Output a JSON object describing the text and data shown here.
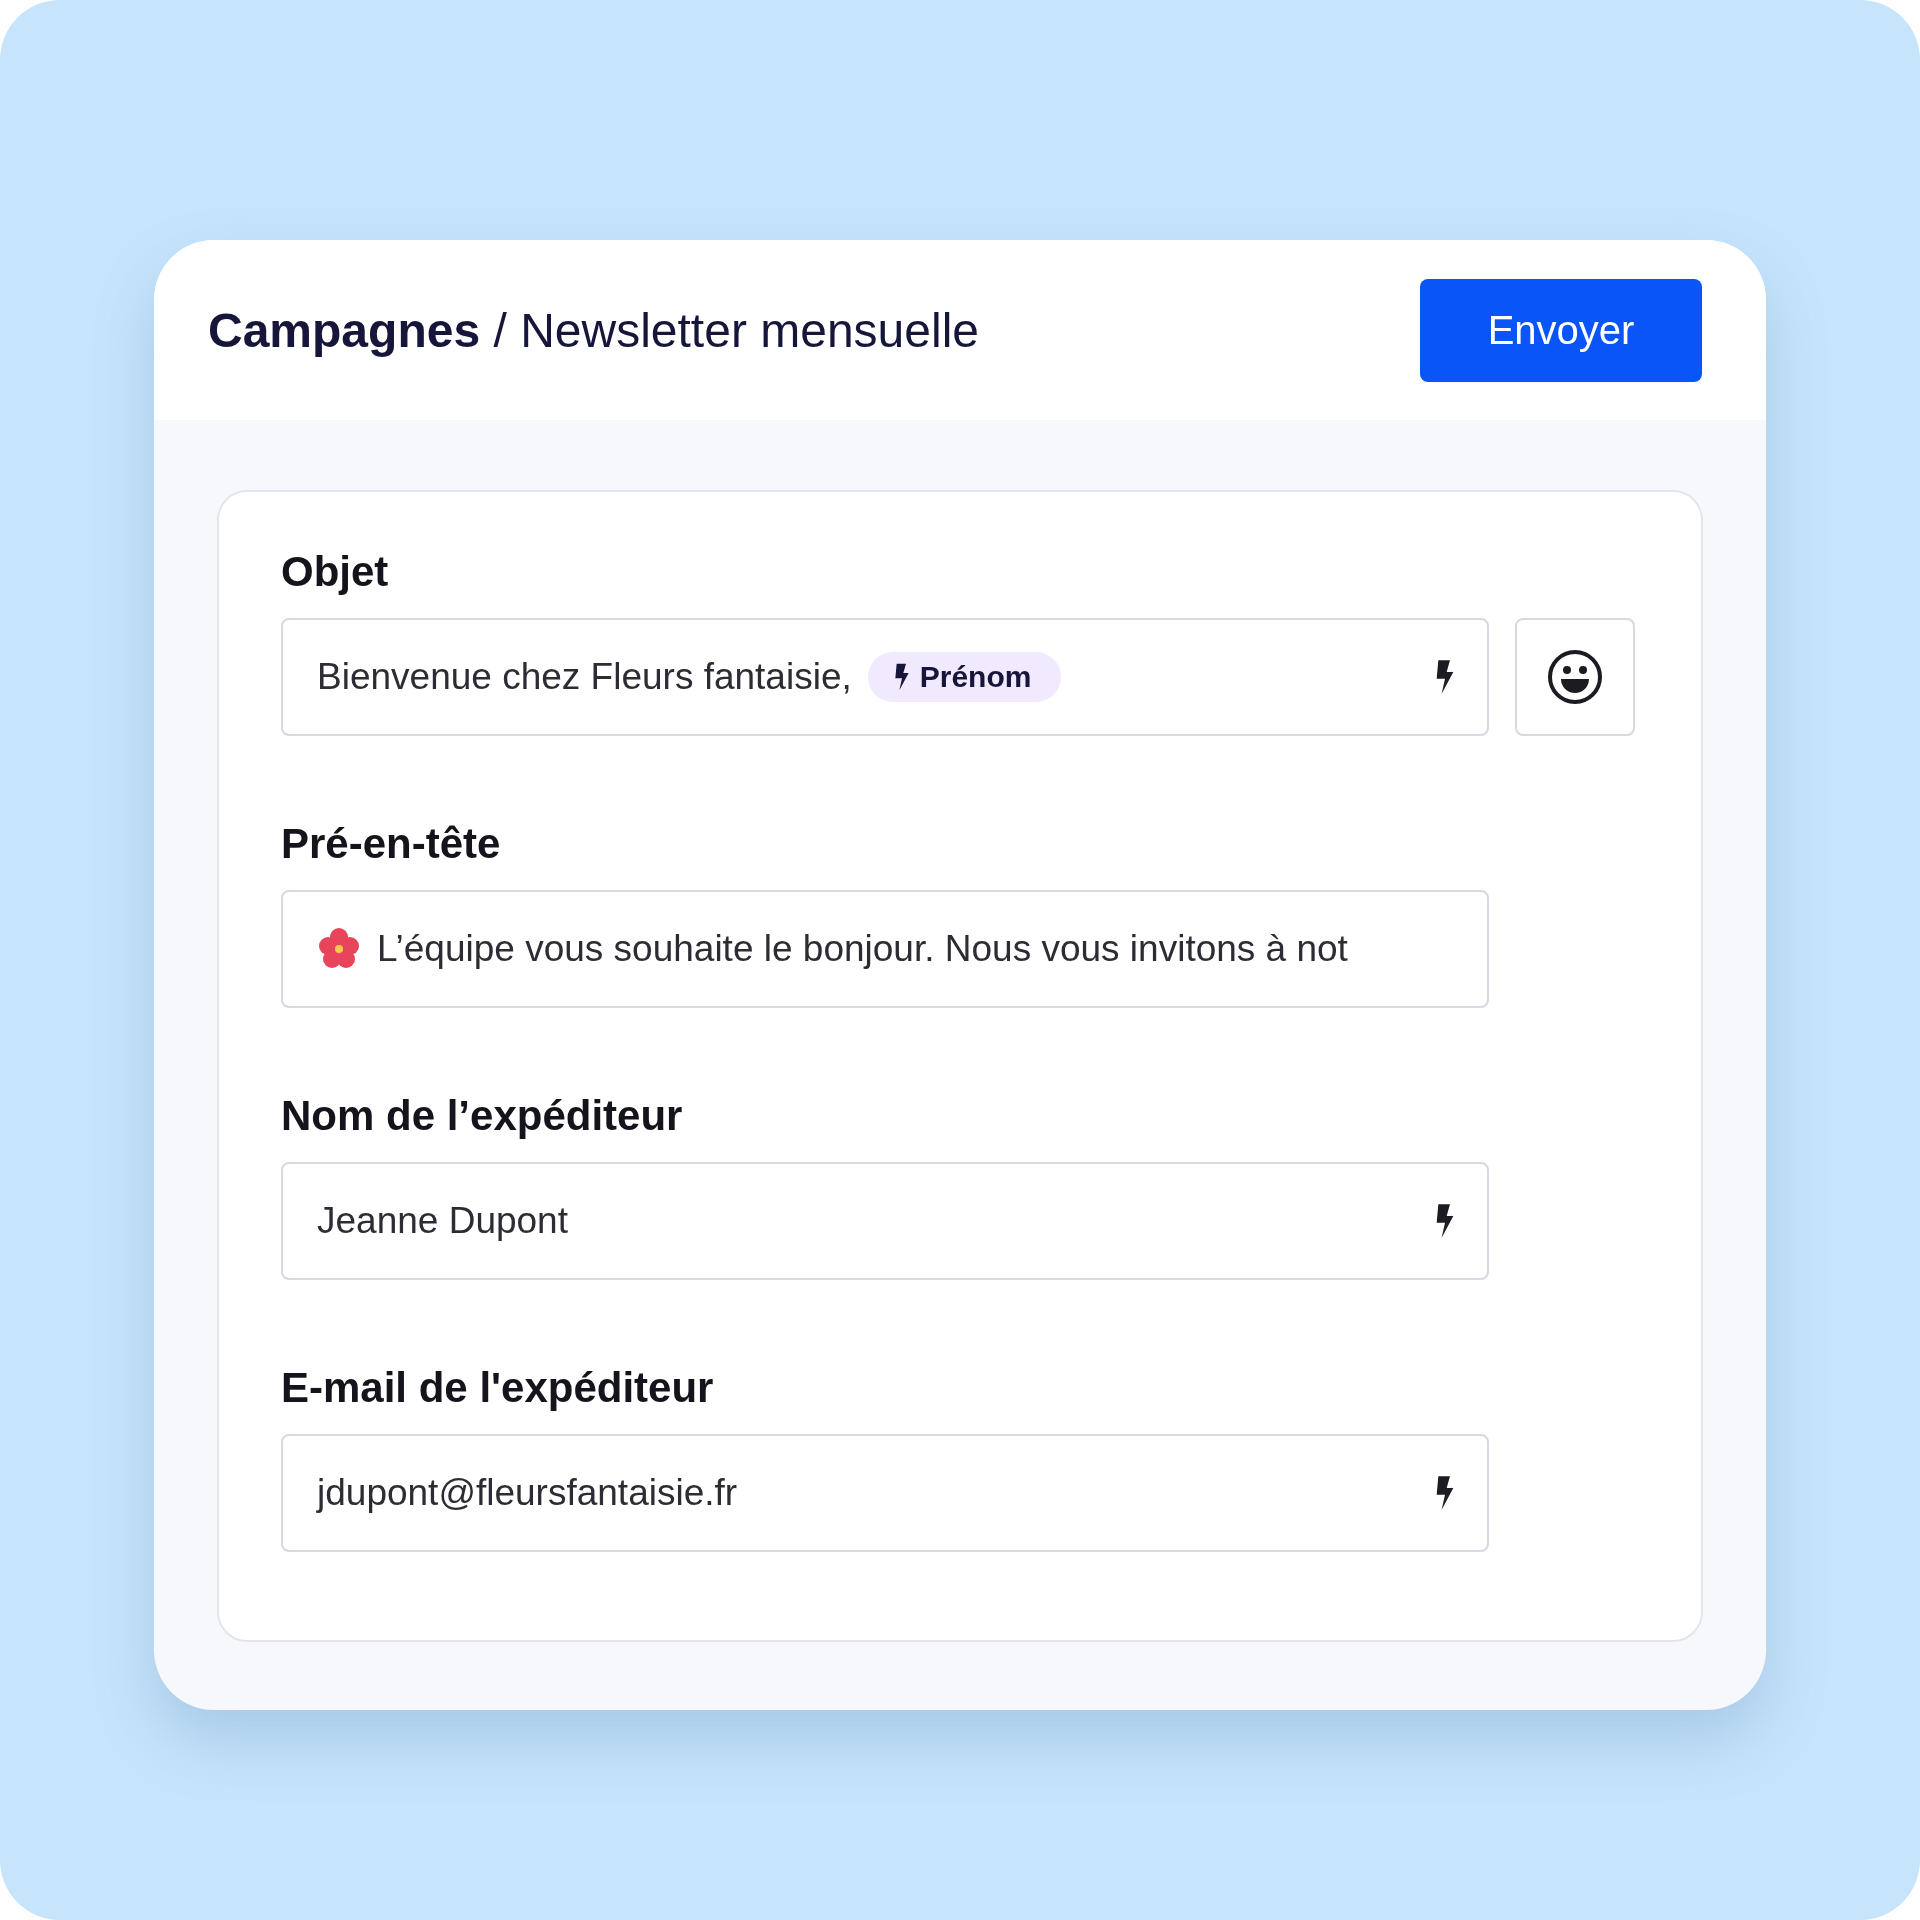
{
  "breadcrumb": {
    "parent": "Campagnes",
    "separator": "/",
    "current": "Newsletter mensuelle"
  },
  "send_button": "Envoyer",
  "fields": [
    {
      "label": "Objet",
      "kind": "subject",
      "value": "Bienvenue chez Fleurs fantaisie,",
      "token": "Prénom",
      "personalize": true
    },
    {
      "label": "Pré-en-tête",
      "kind": "preheader",
      "value": "L’équipe vous souhaite le bonjour. Nous vous invitons à not",
      "personalize": false
    },
    {
      "label": "Nom de l’expéditeur",
      "kind": "plain",
      "value": "Jeanne Dupont",
      "personalize": true
    },
    {
      "label": "E-mail de l'expéditeur",
      "kind": "plain",
      "value": "jdupont@fleursfantaisie.fr",
      "personalize": true
    }
  ]
}
